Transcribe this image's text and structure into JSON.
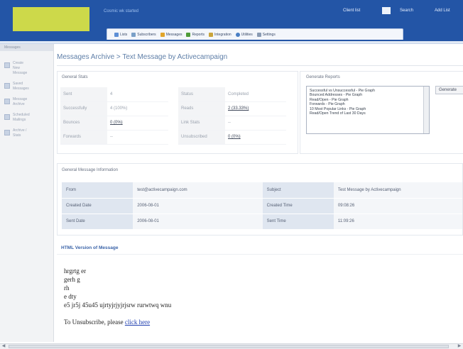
{
  "header": {
    "welcome": "Cosmic wk started",
    "links": [
      "Client list",
      "Search",
      "Add List"
    ],
    "brand_color": "#2355a6",
    "logo_color": "#cdd94a"
  },
  "nav": {
    "items": [
      {
        "label": "Lists",
        "icon": "list-icon",
        "color": "#5d8fd6"
      },
      {
        "label": "Subscribers",
        "icon": "users-icon",
        "color": "#7aa0c8"
      },
      {
        "label": "Messages",
        "icon": "pencil-icon",
        "color": "#e1a52a"
      },
      {
        "label": "Reports",
        "icon": "chart-icon",
        "color": "#4f9c3a"
      },
      {
        "label": "Integration",
        "icon": "integration-icon",
        "color": "#c9a43b"
      },
      {
        "label": "Utilities",
        "icon": "globe-icon",
        "color": "#4a7fc4"
      },
      {
        "label": "Settings",
        "icon": "wrench-icon",
        "color": "#8a9bb3"
      }
    ]
  },
  "sidebar": {
    "heading": "Messages",
    "items": [
      {
        "label": "Create\nNew\nMessage"
      },
      {
        "label": "Saved\nMessages"
      },
      {
        "label": "Message\nArchive"
      },
      {
        "label": "Scheduled\nMailings"
      },
      {
        "label": "Archive /\nStats"
      }
    ]
  },
  "page_title": "Messages Archive > Text Message by Activecampaign",
  "general_stats": {
    "title": "General Stats",
    "left": [
      {
        "label": "Sent",
        "value": "4",
        "link": false
      },
      {
        "label": "Successfully",
        "value": "4 (100%)",
        "link": false
      },
      {
        "label": "Bounces",
        "value": "0 (0%)",
        "link": true
      },
      {
        "label": "Forwards",
        "value": "--",
        "link": false
      }
    ],
    "right": [
      {
        "label": "Status",
        "value": "Completed",
        "link": false
      },
      {
        "label": "Reads",
        "value": "2 (33.33%)",
        "link": true
      },
      {
        "label": "Link Stats",
        "value": "--",
        "link": false
      },
      {
        "label": "Unsubscribed",
        "value": "0 (0%)",
        "link": true
      }
    ]
  },
  "generate_reports": {
    "title": "Generate Reports",
    "options": [
      "Successful vs Unsuccessful - Pie Graph",
      "Bounced Addresses - Pie Graph",
      "Read/Open - Pie Graph",
      "Forwards - Pie Graph",
      "10 Most Popular Links - Pie Graph",
      "Read/Open Trend of Last 30 Days"
    ],
    "button_label": "Generate"
  },
  "message_info": {
    "title": "General Message Information",
    "rows": [
      [
        {
          "label": "From",
          "value": "test@activecampaign.com"
        },
        {
          "label": "Subject",
          "value": "Test Message by Activecampaign"
        }
      ],
      [
        {
          "label": "Created Date",
          "value": "2006-08-01"
        },
        {
          "label": "Created Time",
          "value": "09:08:26"
        }
      ],
      [
        {
          "label": "Sent Date",
          "value": "2006-08-01"
        },
        {
          "label": "Sent Time",
          "value": "11:09:26"
        }
      ]
    ]
  },
  "html_version": {
    "title": "HTML Version of Message",
    "lines": [
      "hrgrtg er",
      "gerh g",
      "rh",
      "e dty",
      "e5 jr5j 45u45 ujrtyjrjyjrjsrw rurwtwq wnu"
    ],
    "unsubscribe_text": "To Unsubscribe, please",
    "unsubscribe_link": "click here"
  }
}
